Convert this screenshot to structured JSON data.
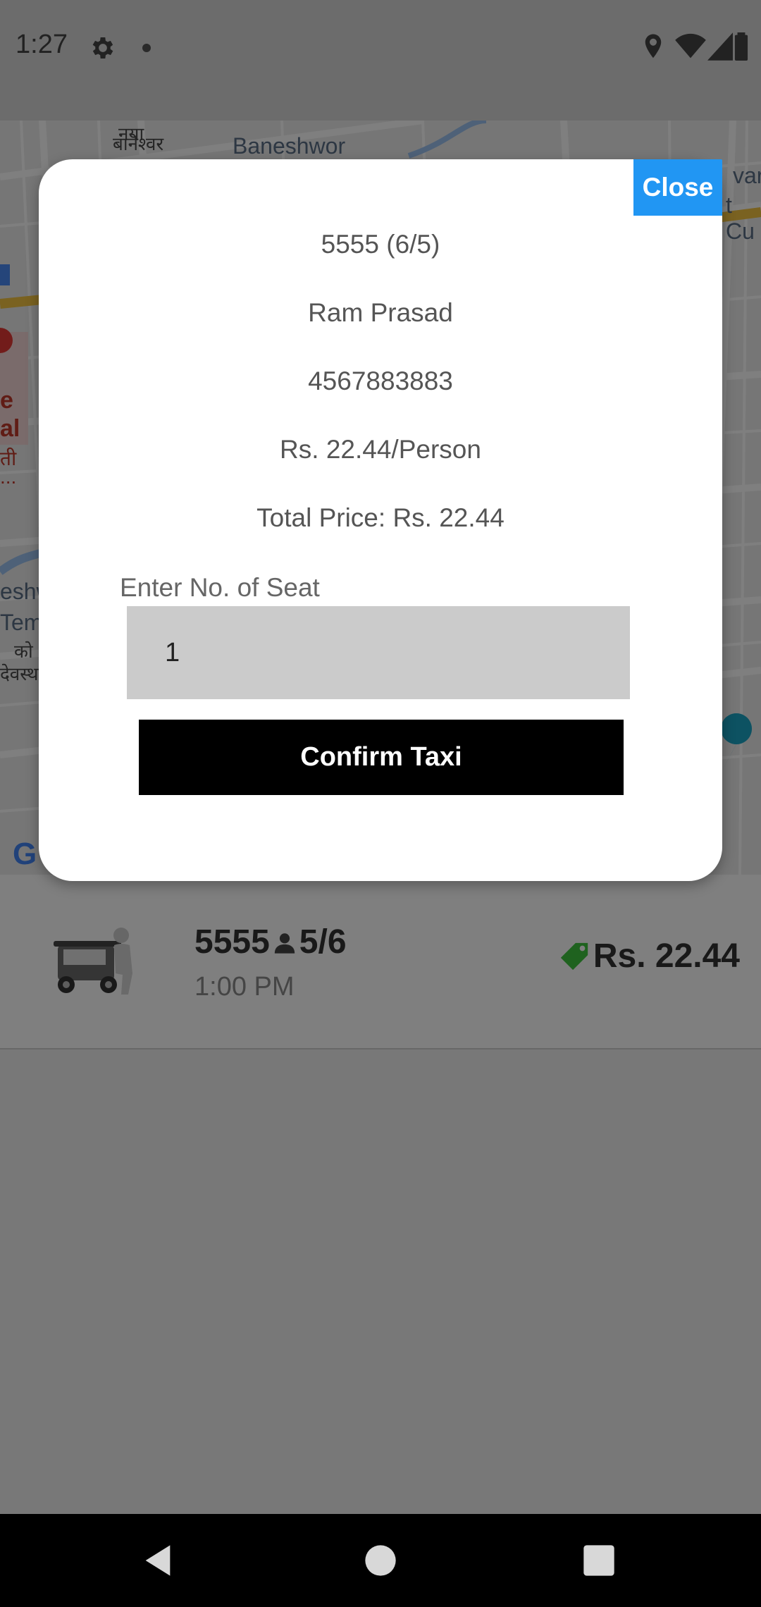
{
  "status_bar": {
    "time": "1:27",
    "icons": [
      "gear-icon",
      "dot-icon",
      "location-icon",
      "wifi-icon",
      "signal-icon",
      "battery-icon"
    ]
  },
  "map": {
    "labels": {
      "baneshwor": "Baneshwor",
      "baneshwor_devanagari": "बानेश्वर",
      "top_devanagari": "नया",
      "right_top": "var",
      "right_top2": "t Cu",
      "left_e": "e",
      "left_al": "al",
      "left_ti": "ती",
      "left_dots": "...",
      "left_eshw": "eshw",
      "left_tem": "Tem",
      "left_ko": "को",
      "left_deva": "देवस्थ",
      "google_g": "G"
    }
  },
  "modal": {
    "close_label": "Close",
    "plate_line": "5555 (6/5)",
    "driver_name": "Ram Prasad",
    "phone": "4567883883",
    "rate": "Rs. 22.44/Person",
    "total": "Total Price: Rs. 22.44",
    "seat_label": "Enter No. of Seat",
    "seat_value": "1",
    "confirm_label": "Confirm Taxi"
  },
  "list": {
    "items": [
      {
        "plate": "5555",
        "seats": "5/6",
        "time": "1:00 PM",
        "price": "Rs. 22.44"
      }
    ]
  },
  "colors": {
    "close_button": "#2196f3",
    "confirm_button": "#000000",
    "price_tag": "#3ec43e",
    "seat_input_bg": "#cbcbcb"
  }
}
